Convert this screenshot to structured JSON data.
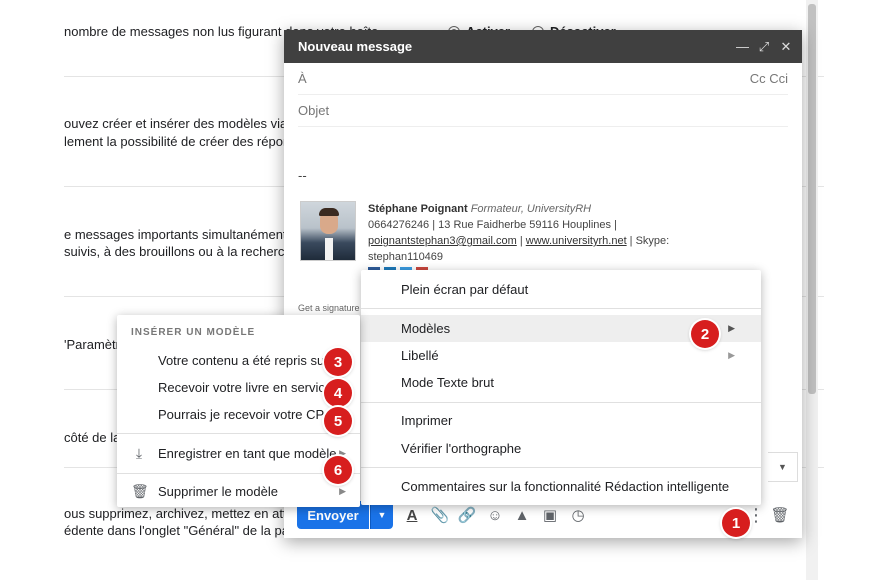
{
  "background": {
    "lines": [
      "nombre de messages non lus figurant dans votre boîte",
      "ouvez créer et insérer des modèles via le",
      "lement la possibilité de créer des réponse",
      "e messages importants simultanément. L",
      "suivis, à des brouillons ou à la recherche c",
      "'Paramètre",
      "côté de la",
      "ous supprimez, archivez, mettez en attent",
      "édente dans l'onglet \"Général\" de la page"
    ],
    "radio_on": "Activer",
    "radio_off": "Désactiver"
  },
  "compose": {
    "title": "Nouveau message",
    "to_label": "À",
    "cc_label": "Cc Cci",
    "subject_placeholder": "Objet",
    "sig_dash": "--",
    "signature": {
      "name": "Stéphane Poignant",
      "role": "Formateur, UniversityRH",
      "line2": "0664276246 | 13 Rue Faidherbe 59116 Houplines |",
      "email": "poignantstephan3@gmail.com",
      "sep1": " | ",
      "website": "www.universityrh.net",
      "skype": " | Skype:",
      "skype_id": "stephan110469"
    },
    "get_signature": "Get a signature",
    "send_label": "Envoyer"
  },
  "main_menu": {
    "items": [
      "Plein écran par défaut",
      "Modèles",
      "Libellé",
      "Mode Texte brut",
      "Imprimer",
      "Vérifier l'orthographe",
      "Commentaires sur la fonctionnalité Rédaction intelligente"
    ]
  },
  "template_menu": {
    "header": "INSÉRER UN MODÈLE",
    "templates": [
      "Votre contenu a été repris su...",
      "Recevoir votre livre en servic...",
      "Pourrais je recevoir votre CP ..."
    ],
    "save_label": "Enregistrer en tant que modèle",
    "delete_label": "Supprimer le modèle"
  },
  "badges": [
    "1",
    "2",
    "3",
    "4",
    "5",
    "6"
  ],
  "colors": {
    "accent": "#1a73e8",
    "header": "#404040",
    "badge": "#d71e1e"
  }
}
